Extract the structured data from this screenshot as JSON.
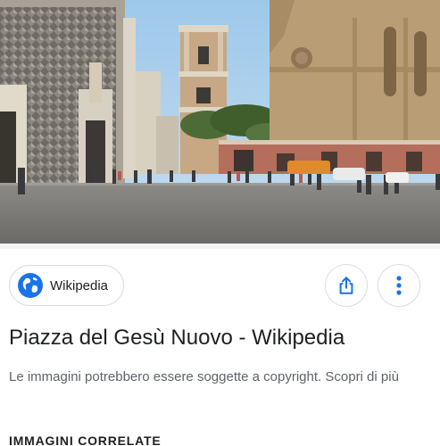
{
  "result": {
    "source": {
      "name": "Wikipedia",
      "icon": "globe-icon",
      "icon_color": "#1a73e8"
    },
    "share_icon": "share-icon",
    "more_icon": "more-vertical-icon",
    "accent_color": "#1a73e8",
    "title": "Piazza del Gesù Nuovo - Wikipedia",
    "copyright_notice": "Le immagini potrebbero essere soggette a copyright.",
    "more_info_link": "Scopri di più"
  },
  "related": {
    "heading": "IMMAGINI CORRELATE"
  }
}
